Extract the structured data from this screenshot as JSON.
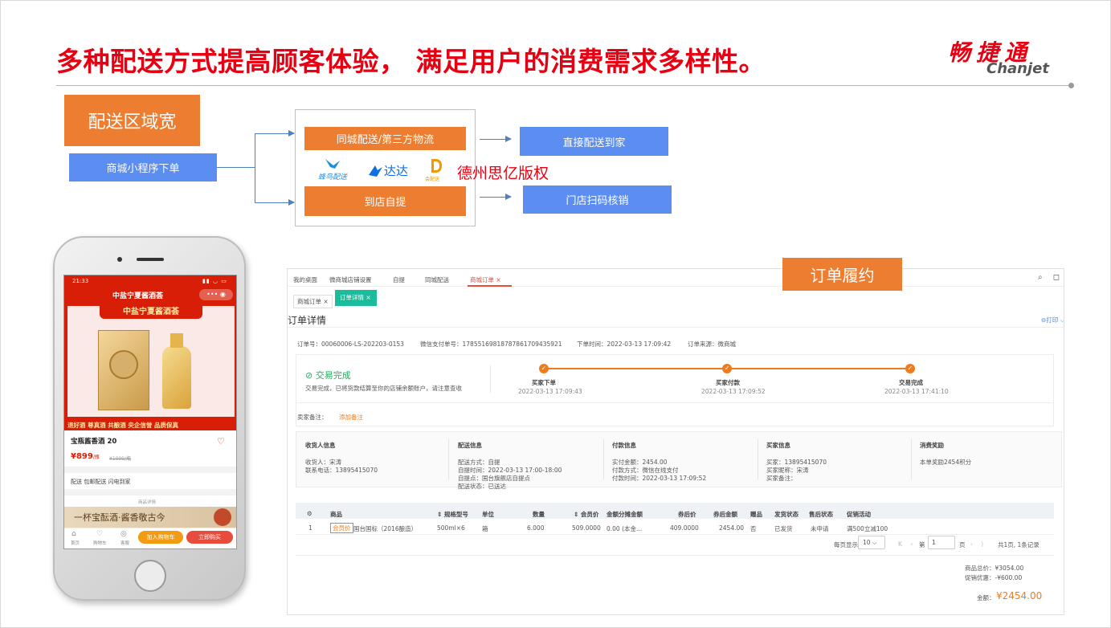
{
  "slide": {
    "title": "多种配送方式提高顾客体验， 满足用户的消费需求多样性。",
    "logo_cn": "畅捷通",
    "logo_en": "Chanjet",
    "watermark": "德州思亿版权"
  },
  "flow": {
    "region_label": "配送区域宽",
    "order_source": "商城小程序下单",
    "city_delivery": "同城配送/第三方物流",
    "pickup": "到店自提",
    "direct_home": "直接配送到家",
    "store_scan": "门店扫码核销",
    "partner_logos": [
      "蜂鸟配送",
      "达达",
      "会配送"
    ]
  },
  "phone": {
    "status_time": "21:33",
    "shop_name": "中盐宁夏酱酒荟",
    "banner": "中盐宁夏酱酒荟",
    "promo_tags": "退好酒 尊真酒 共酿酒 央企信誉 品质保真",
    "product_name": "宝瓶酱香酒 20",
    "price": "¥899",
    "price_unit": "/瓶",
    "original_price": "¥1099/瓶",
    "delivery_info": "配送  包邮配送 闪电到家",
    "more_text": "商品详情",
    "poster_text": "一杯宝酝酒·酱香敬古今",
    "nav": [
      "首页",
      "购物车",
      "客服"
    ],
    "add_cart": "加入购物车",
    "buy_now": "立即购买"
  },
  "fulfillment_label": "订单履约",
  "admin": {
    "tabs": [
      "我的桌面",
      "微商城店铺设置",
      "自提",
      "同城配送",
      "商城订单"
    ],
    "active_tab": "商城订单",
    "subtabs": [
      "商城订单",
      "订单详情"
    ],
    "page_title": "订单详情",
    "print_label": "打印",
    "order_meta": {
      "order_no": "订单号：00060006-LS-202203-0153",
      "wx_pay_no": "微信支付单号：17855169818787861709435921",
      "order_time": "下单时间：2022-03-13 17:09:42",
      "order_source": "订单来源：微商城"
    },
    "status": {
      "title": "交易完成",
      "desc": "交易完成，已将货款结算至你的店铺余额账户，请注意查收",
      "steps": [
        {
          "name": "买家下单",
          "time": "2022-03-13 17:09:43"
        },
        {
          "name": "买家付款",
          "time": "2022-03-13 17:09:52"
        },
        {
          "name": "交易完成",
          "time": "2022-03-13 17:41:10"
        }
      ]
    },
    "seller_note_label": "卖家备注：",
    "seller_note_link": "添加备注",
    "info_blocks": [
      {
        "title": "收货人信息",
        "lines": [
          "收货人：宋涛",
          "联系电话：13895415070"
        ]
      },
      {
        "title": "配送信息",
        "lines": [
          "配送方式：自提",
          "自提时间：2022-03-13 17:00-18:00",
          "自提点：国台旗舰店自提点",
          "配送状态：已送达"
        ]
      },
      {
        "title": "付款信息",
        "lines": [
          "实付金额：2454.00",
          "付款方式：微信在线支付",
          "付款时间：2022-03-13 17:09:52"
        ]
      },
      {
        "title": "买家信息",
        "lines": [
          "买家：13895415070",
          "买家昵称：宋涛",
          "买家备注："
        ]
      },
      {
        "title": "消费奖励",
        "lines": [
          "本单奖励2454积分"
        ]
      }
    ],
    "table": {
      "headers": [
        "商品",
        "规格型号",
        "单位",
        "数量",
        "会员价",
        "金额分摊金额",
        "券后价",
        "券后金额",
        "赠品",
        "发货状态",
        "售后状态",
        "促销活动"
      ],
      "row": {
        "index": "1",
        "badge": "会员价",
        "product": "国台国标（2016酿造）",
        "spec": "500ml×6",
        "unit": "箱",
        "qty": "6.000",
        "member_price": "509.0000",
        "alloc": "0.00 (本金...",
        "after_coupon": "409.0000",
        "after_total": "2454.00",
        "gift": "否",
        "ship_status": "已发货",
        "aftersale": "未申请",
        "promo": "满500立减100"
      }
    },
    "pagination": {
      "per_page_label": "每页显示",
      "per_page": "10",
      "page_prefix": "第",
      "page": "1",
      "page_suffix": "页",
      "summary": "共1页, 1条记录"
    },
    "totals": {
      "goods_total": "商品总价：¥3054.00",
      "discount": "促销优惠：-¥600.00",
      "pay_label": "金额：",
      "pay_amount": "¥2454.00"
    }
  },
  "colors": {
    "title_red": "#e60012",
    "flow_orange": "#ed7d31",
    "flow_blue": "#5b8ef0",
    "tab_active": "#1abc9c",
    "price_orange": "#f07b1d"
  }
}
